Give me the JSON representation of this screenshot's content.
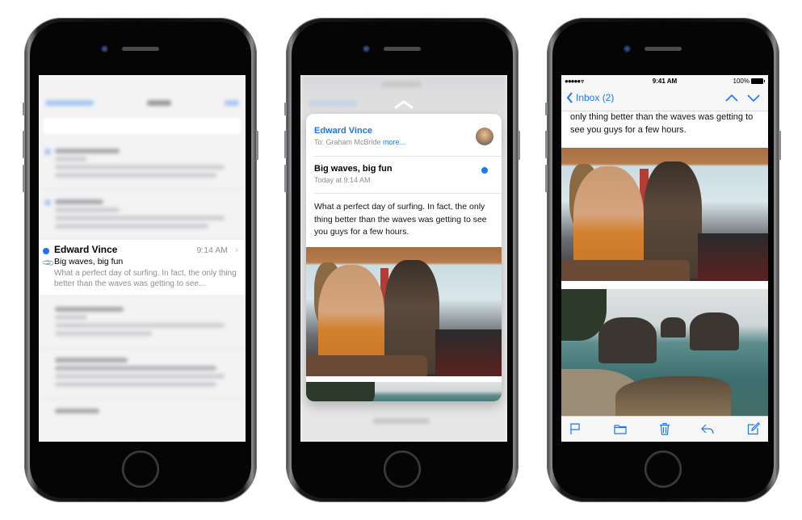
{
  "colors": {
    "accent": "#1a76f1",
    "secondary_text": "#8e8e93",
    "phone_body": "#0a0a0a"
  },
  "phone_left": {
    "description": "blurred inbox list",
    "focused_message": {
      "unread_icon": "blue-dot",
      "attachment_icon": "paperclip-icon",
      "sender": "Edward Vince",
      "time": "9:14 AM",
      "chevron_icon": "chevron-right-icon",
      "subject": "Big waves, big fun",
      "preview": "What a perfect day of surfing. In fact, the only thing better than the waves was getting to see..."
    }
  },
  "phone_middle": {
    "peek_chevron_icon": "chevron-up-icon",
    "peek": {
      "from": "Edward Vince",
      "to_prefix": "To: Graham McBride",
      "more_link": "more...",
      "avatar_icon": "avatar",
      "subject": "Big waves, big fun",
      "date": "Today at 9:14 AM",
      "unread_icon": "blue-dot",
      "body": "What a perfect day of surfing. In fact, the only thing better than the waves was getting to see you guys for a few hours."
    }
  },
  "phone_right": {
    "status": {
      "signal": "●●●●● ",
      "wifi_icon": "wifi-icon",
      "time": "9:41 AM",
      "battery": "100%"
    },
    "nav": {
      "back_label": "Inbox (2)",
      "back_icon": "chevron-left-icon",
      "prev_icon": "chevron-up-icon",
      "next_icon": "chevron-down-icon"
    },
    "body_text": "only thing better than the waves was getting to see you guys for a few hours.",
    "toolbar": [
      {
        "icon": "flag-icon",
        "label": "Flag"
      },
      {
        "icon": "folder-icon",
        "label": "Move"
      },
      {
        "icon": "trash-icon",
        "label": "Trash"
      },
      {
        "icon": "reply-icon",
        "label": "Reply"
      },
      {
        "icon": "compose-icon",
        "label": "Compose"
      }
    ]
  }
}
